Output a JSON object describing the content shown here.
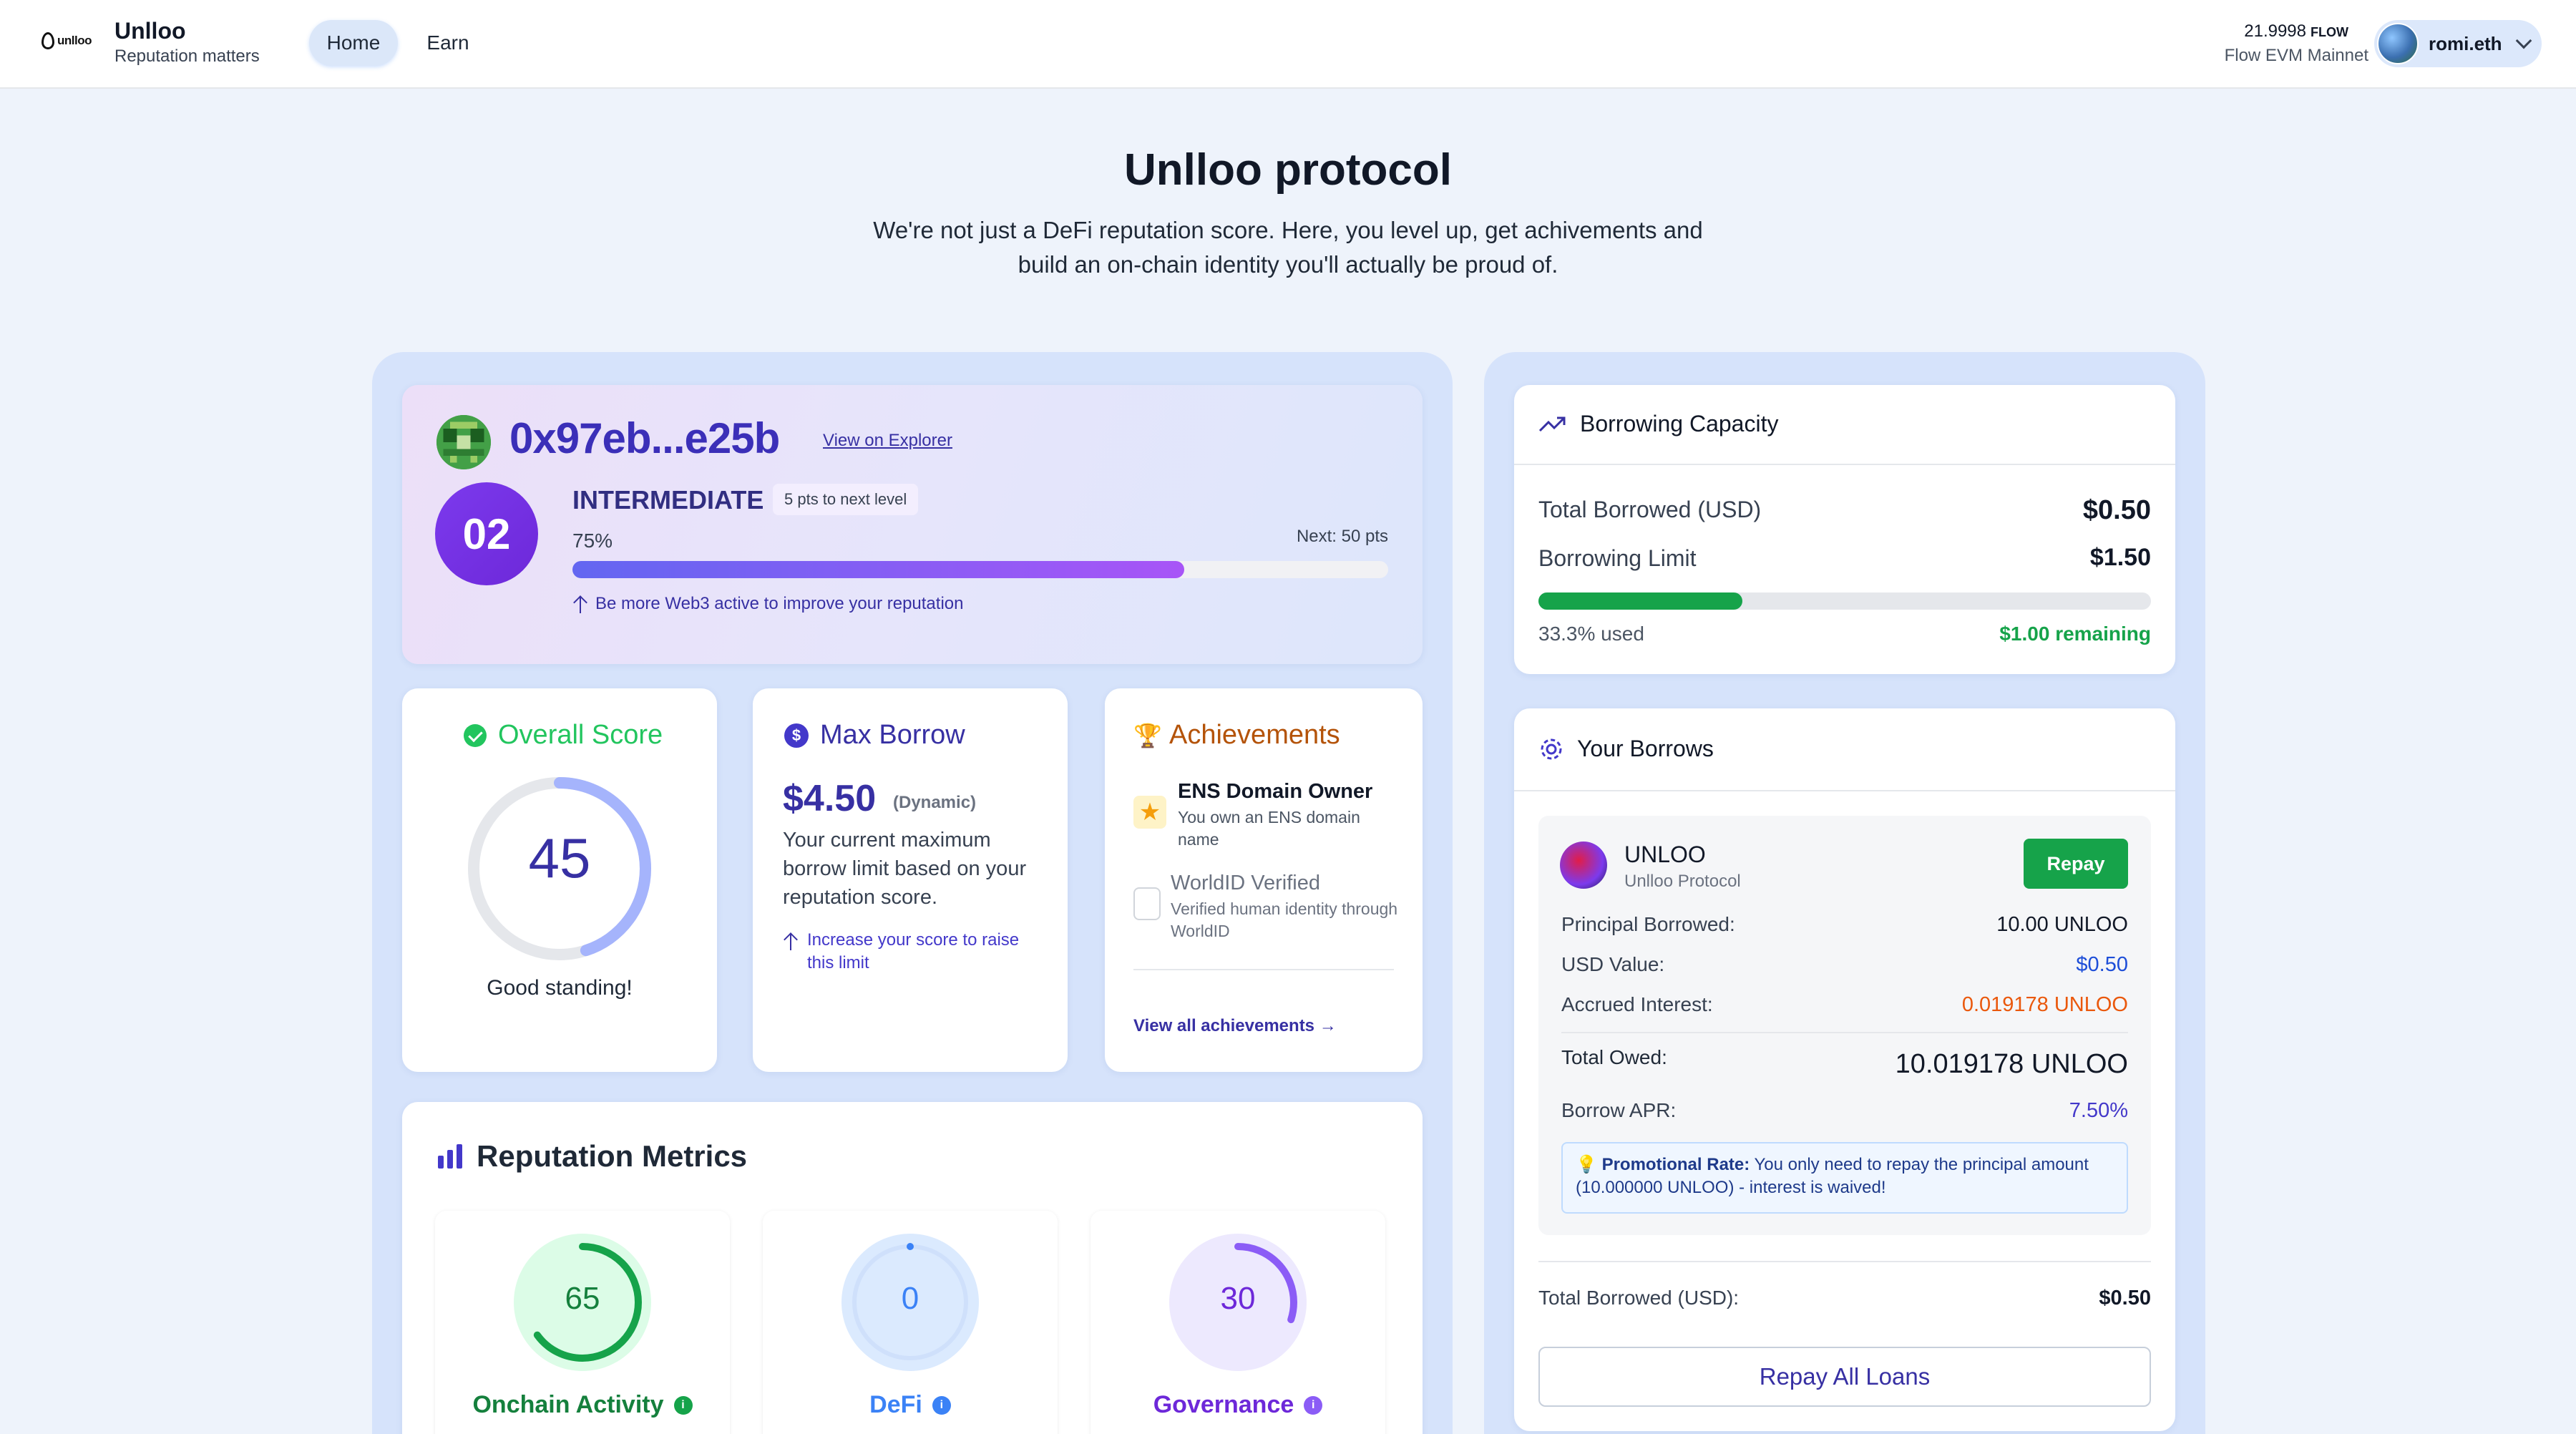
{
  "header": {
    "logo_text": "unlloo",
    "brand": "Unlloo",
    "tagline": "Reputation matters",
    "nav": [
      {
        "label": "Home",
        "active": true
      },
      {
        "label": "Earn",
        "active": false
      }
    ],
    "balance_value": "21.9998",
    "balance_unit": "FLOW",
    "network": "Flow EVM Mainnet",
    "account": "romi.eth"
  },
  "hero": {
    "title": "Unlloo protocol",
    "subtitle_line1": "We're not just a DeFi reputation score. Here, you level up, get achivements and",
    "subtitle_line2": "build an on-chain identity you'll actually be proud of."
  },
  "profile": {
    "address": "0x97eb...e25b",
    "explorer_link": "View on Explorer",
    "level_number": "02",
    "level_name": "INTERMEDIATE",
    "next_level_badge": "5 pts to next level",
    "progress_label": "75%",
    "progress": 0.75,
    "next_label": "Next: 50 pts",
    "hint": "Be more Web3 active to improve your reputation"
  },
  "score_card": {
    "title": "Overall Score",
    "score": "45",
    "score_fraction": 0.45,
    "status": "Good standing!",
    "color": "#22c55e"
  },
  "borrow_card": {
    "title": "Max Borrow",
    "value": "$4.50",
    "qualifier": "(Dynamic)",
    "description": "Your current maximum borrow limit based on your reputation score.",
    "hint": "Increase your score to raise this limit"
  },
  "achievements": {
    "title": "Achievements",
    "items": [
      {
        "title": "ENS Domain Owner",
        "desc": "You own an ENS domain name",
        "unlocked": true
      },
      {
        "title": "WorldID Verified",
        "desc": "Verified human identity through WorldID",
        "unlocked": false
      }
    ],
    "link": "View all achievements →"
  },
  "metrics": {
    "title": "Reputation Metrics",
    "items": [
      {
        "label": "Onchain Activity",
        "value": "65",
        "fraction": 0.65,
        "color": "#16a34a",
        "bg": "#dcfce7",
        "text_color": "#15803d"
      },
      {
        "label": "DeFi",
        "value": "0",
        "fraction": 0.0,
        "color": "#3b82f6",
        "bg": "#dbeafe",
        "text_color": "#3b82f6"
      },
      {
        "label": "Governance",
        "value": "30",
        "fraction": 0.3,
        "color": "#8b5cf6",
        "bg": "#ede9fe",
        "text_color": "#6d28d9"
      }
    ]
  },
  "capacity": {
    "title": "Borrowing Capacity",
    "total_borrowed_label": "Total Borrowed (USD)",
    "total_borrowed_value": "$0.50",
    "limit_label": "Borrowing Limit",
    "limit_value": "$1.50",
    "used_fraction": 0.333,
    "used_label": "33.3% used",
    "remaining_label": "$1.00 remaining"
  },
  "borrows": {
    "title": "Your Borrows",
    "loan": {
      "token": "UNLOO",
      "protocol": "Unlloo Protocol",
      "repay_label": "Repay",
      "principal_label": "Principal Borrowed:",
      "principal_value": "10.00 UNLOO",
      "usd_label": "USD Value:",
      "usd_value": "$0.50",
      "interest_label": "Accrued Interest:",
      "interest_value": "0.019178 UNLOO",
      "owed_label": "Total Owed:",
      "owed_value": "10.019178 UNLOO",
      "apr_label": "Borrow APR:",
      "apr_value": "7.50%",
      "promo_icon": "💡",
      "promo_title": "Promotional Rate:",
      "promo_text": "You only need to repay the principal amount (10.000000 UNLOO) - interest is waived!"
    },
    "total_label": "Total Borrowed (USD):",
    "total_value": "$0.50",
    "repay_all_label": "Repay All Loans"
  },
  "icons": {
    "logo": "drop-logo-icon",
    "overall": "check-circle-icon",
    "borrow": "dollar-circle-icon",
    "achievements": "trophy-icon",
    "metrics": "bar-chart-icon",
    "capacity": "trending-up-icon",
    "borrows": "gear-icon"
  }
}
